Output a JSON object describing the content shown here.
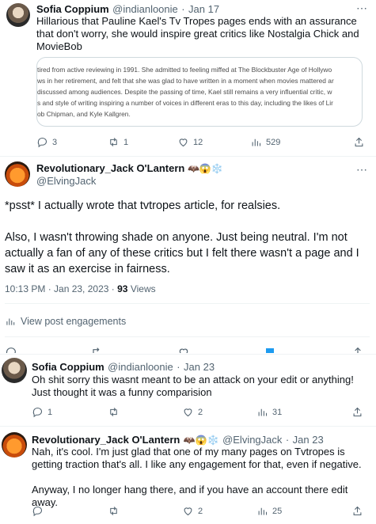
{
  "tweet1": {
    "name": "Sofia Coppium",
    "handle": "@indianloonie",
    "dot": "·",
    "date": "Jan 17",
    "text": "Hillarious that Pauline Kael's Tv Tropes pages ends with an assurance that don't worry, she would inspire great critics like Nostalgia Chick and MovieBob",
    "quote_lines": [
      "tired from active reviewing in 1991. She admitted to feeling miffed at The Blockbuster Age of Hollywo",
      "ws in her retirement, and felt that she was glad to have written in a moment when movies mattered ar",
      " discussed among audiences. Despite the passing of time, Kael still remains a very influential critic, w",
      "s and style of writing inspiring a number of voices in different eras to this day, including the likes of Lir",
      "ob Chipman, and Kyle Kallgren."
    ],
    "replies": "3",
    "retweets": "1",
    "likes": "12",
    "views": "529"
  },
  "tweet2": {
    "name": "Revolutionary_Jack O'Lantern",
    "emojis": "🦇😱❄️",
    "handle": "@ElvingJack",
    "text1": "*psst* I actually wrote that tvtropes article, for realsies.",
    "text2": "Also, I wasn't throwing shade on anyone. Just being neutral. I'm not actually a fan of any of these critics but I felt there wasn't a page and I saw it as an exercise in fairness.",
    "time": "10:13 PM · Jan 23, 2023",
    "dot": "·",
    "views_count": "93",
    "views_label": "Views",
    "engagements": "View post engagements"
  },
  "reply1": {
    "name": "Sofia Coppium",
    "handle": "@indianloonie",
    "dot": "·",
    "date": "Jan 23",
    "text": "Oh shit sorry this wasnt meant to be an attack on your edit or anything! Just thought it was a funny comparision",
    "replies": "1",
    "retweets": "",
    "likes": "2",
    "views": "31"
  },
  "reply2": {
    "name": "Revolutionary_Jack O'Lantern",
    "emojis": "🦇😱❄️",
    "handle": "@ElvingJack",
    "dot": "·",
    "date": "Jan 23",
    "text1": "Nah, it's cool. I'm just glad that one of my many pages on Tvtropes is getting traction that's all. I like any engagement for that, even if negative.",
    "text2": "Anyway, I no longer hang there, and if you have an account there edit away.",
    "replies": "",
    "retweets": "",
    "likes": "2",
    "views": "25"
  },
  "colors": {
    "link": "#1d9bf0",
    "muted": "#536471",
    "divider": "#eff3f4"
  }
}
